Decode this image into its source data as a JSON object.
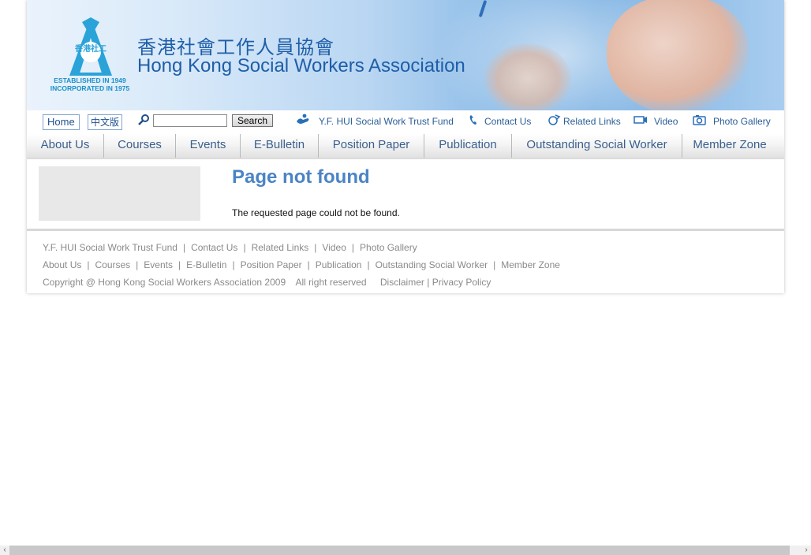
{
  "banner": {
    "title_zh": "香港社會工作人員協會",
    "title_en": "Hong Kong Social Workers Association",
    "logo_text": "香港社工",
    "established": "ESTABLISHED IN 1949",
    "incorporated": "INCORPORATED IN 1975"
  },
  "toolbar": {
    "home": "Home",
    "lang": "中文版",
    "search_placeholder": "",
    "search_button": "Search",
    "links": [
      {
        "label": "Y.F. HUI Social Work Trust Fund",
        "icon": "hand-icon"
      },
      {
        "label": "Contact Us",
        "icon": "phone-icon"
      },
      {
        "label": "Related Links",
        "icon": "link-icon"
      },
      {
        "label": "Video",
        "icon": "video-icon"
      },
      {
        "label": "Photo Gallery",
        "icon": "camera-icon"
      }
    ]
  },
  "nav": [
    "About Us",
    "Courses",
    "Events",
    "E-Bulletin",
    "Position Paper",
    "Publication",
    "Outstanding Social Worker",
    "Member Zone"
  ],
  "content": {
    "heading": "Page not found",
    "message": "The requested page could not be found."
  },
  "footer": {
    "row1": [
      "Y.F. HUI Social Work Trust Fund",
      "Contact Us",
      "Related Links",
      "Video",
      "Photo Gallery"
    ],
    "row2": [
      "About Us",
      "Courses",
      "Events",
      "E-Bulletin",
      "Position Paper",
      "Publication",
      "Outstanding Social Worker",
      "Member Zone"
    ],
    "copyright": "Copyright @ Hong Kong Social Workers Association 2009",
    "rights": "All right reserved",
    "disclaimer": "Disclaimer",
    "privacy": "Privacy Policy"
  },
  "colors": {
    "brand_blue": "#1f5ea8",
    "heading_blue": "#4b84c4",
    "link_blue": "#2a5d96",
    "footer_gray": "#8a8a8a"
  }
}
